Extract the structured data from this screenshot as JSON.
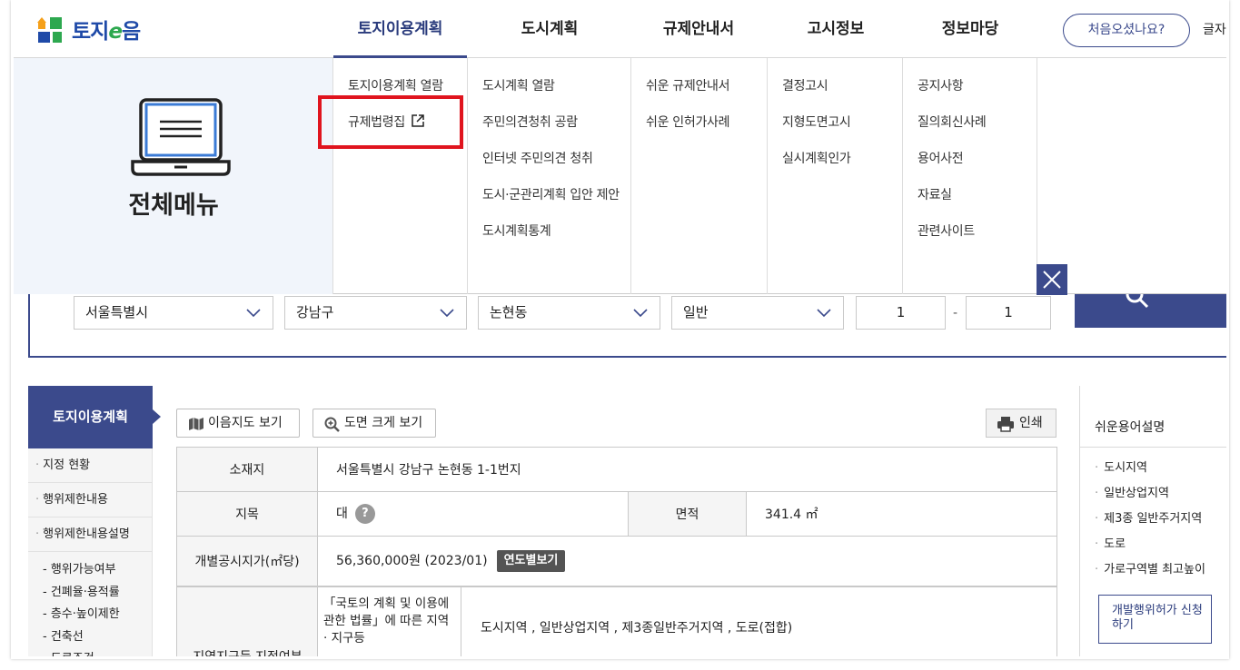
{
  "brand": {
    "name_part1": "토지",
    "name_part2": "e",
    "name_part3": "음"
  },
  "gnb": [
    {
      "label": "토지이용계획",
      "active": true
    },
    {
      "label": "도시계획"
    },
    {
      "label": "규제안내서"
    },
    {
      "label": "고시정보"
    },
    {
      "label": "정보마당"
    }
  ],
  "header": {
    "first_visit": "처음오셨나요?",
    "font_size": "글자"
  },
  "mega_menu": {
    "title": "전체메뉴",
    "col1": [
      "토지이용계획 열람",
      "규제법령집"
    ],
    "col2": [
      "도시계획 열람",
      "주민의견청취 공람",
      "인터넷 주민의견 청취",
      "도시·군관리계획 입안 제안",
      "도시계획통계"
    ],
    "col3": [
      "쉬운 규제안내서",
      "쉬운 인허가사례"
    ],
    "col4": [
      "결정고시",
      "지형도면고시",
      "실시계획인가"
    ],
    "col5": [
      "공지사항",
      "질의회신사례",
      "용어사전",
      "자료실",
      "관련사이트"
    ]
  },
  "search": {
    "sido": "서울특별시",
    "sigungu": "강남구",
    "dong": "논현동",
    "type": "일반",
    "bonbun": "1",
    "dash": "-",
    "bubun": "1"
  },
  "sidebar": {
    "title": "토지이용계획",
    "items": [
      "지정 현황",
      "행위제한내용",
      "행위제한내용설명"
    ],
    "sub_items": [
      "- 행위가능여부",
      "- 건폐율·용적률",
      "- 층수·높이제한",
      "- 건축선",
      "- 도로조건"
    ]
  },
  "toolbar": {
    "map_view": "이음지도 보기",
    "zoom_view": "도면 크게 보기",
    "print": "인쇄"
  },
  "land_info": {
    "location_label": "소재지",
    "location_value": "서울특별시 강남구 논현동 1-1번지",
    "jimok_label": "지목",
    "jimok_value": "대",
    "help": "?",
    "area_label": "면적",
    "area_value": "341.4 ㎡",
    "price_label": "개별공시지가(㎡당)",
    "price_value": "56,360,000원 (2023/01)",
    "year_btn": "연도별보기",
    "zone_label": "지역지구등 지정여부",
    "zone_sub_label": "「국토의 계획 및 이용에 관한 법률」에 따른 지역 · 지구등",
    "zone_value": "도시지역 , 일반상업지역 , 제3종일반주거지역 , 도로(접합)"
  },
  "glossary": {
    "title": "쉬운용어설명",
    "items": [
      "도시지역",
      "일반상업지역",
      "제3종 일반주거지역",
      "도로",
      "가로구역별 최고높이"
    ],
    "permit_btn": "개발행위허가 신청하기"
  },
  "colors": {
    "accent": "#3b4a8c",
    "highlight": "#e0141e",
    "menu_bg": "#f1f5fb"
  }
}
